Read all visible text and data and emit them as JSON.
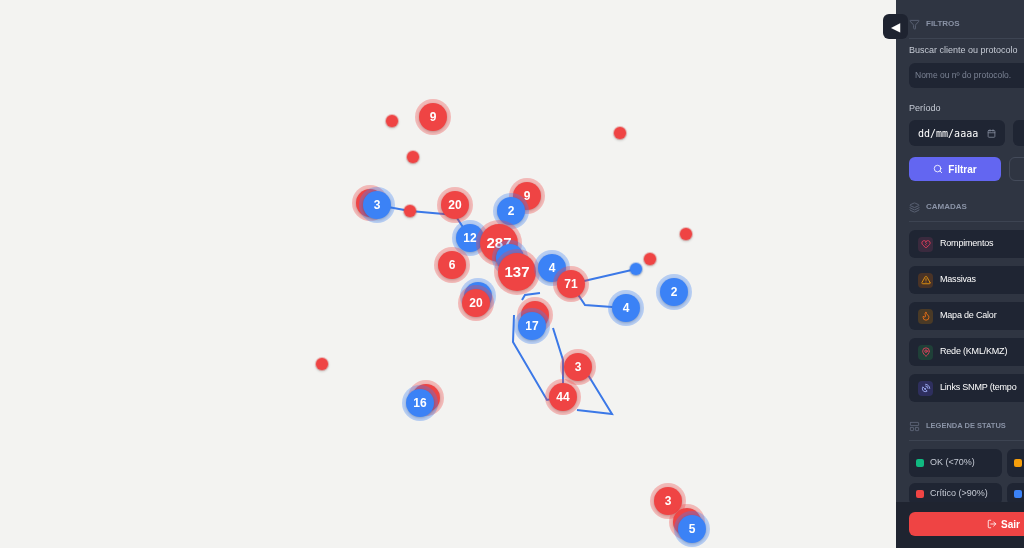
{
  "map": {
    "markers": [
      {
        "kind": "cluster",
        "color": "#ef4444",
        "count": "9"
      },
      {
        "kind": "dot",
        "color": "#ef4444"
      },
      {
        "kind": "dot",
        "color": "#ef4444"
      },
      {
        "kind": "dot",
        "color": "#ef4444"
      },
      {
        "kind": "cluster",
        "color": "#ef4444",
        "count": "9"
      },
      {
        "kind": "cluster",
        "color": "#ef4444"
      },
      {
        "kind": "cluster",
        "color": "#3b82f6",
        "count": "3"
      },
      {
        "kind": "cluster",
        "color": "#ef4444",
        "count": "20"
      },
      {
        "kind": "dot",
        "color": "#ef4444"
      },
      {
        "kind": "cluster",
        "color": "#3b82f6",
        "count": "2"
      },
      {
        "kind": "dot",
        "color": "#ef4444"
      },
      {
        "kind": "cluster",
        "color": "#3b82f6",
        "count": "12"
      },
      {
        "kind": "large",
        "color": "#ef4444",
        "count": "287"
      },
      {
        "kind": "cluster",
        "color": "#3b82f6"
      },
      {
        "kind": "dot",
        "color": "#ef4444"
      },
      {
        "kind": "cluster",
        "color": "#ef4444",
        "count": "6"
      },
      {
        "kind": "large",
        "color": "#ef4444",
        "count": "137"
      },
      {
        "kind": "cluster",
        "color": "#3b82f6",
        "count": "4"
      },
      {
        "kind": "dot",
        "color": "#3b82f6"
      },
      {
        "kind": "cluster",
        "color": "#ef4444",
        "count": "71"
      },
      {
        "kind": "cluster",
        "color": "#3b82f6",
        "count": "2"
      },
      {
        "kind": "cluster",
        "color": "#3b82f6"
      },
      {
        "kind": "cluster",
        "color": "#ef4444",
        "count": "20"
      },
      {
        "kind": "cluster",
        "color": "#3b82f6",
        "count": "4"
      },
      {
        "kind": "cluster",
        "color": "#ef4444"
      },
      {
        "kind": "cluster",
        "color": "#3b82f6",
        "count": "17"
      },
      {
        "kind": "dot",
        "color": "#ef4444"
      },
      {
        "kind": "cluster",
        "color": "#ef4444",
        "count": "3"
      },
      {
        "kind": "cluster",
        "color": "#ef4444"
      },
      {
        "kind": "cluster",
        "color": "#3b82f6",
        "count": "16"
      },
      {
        "kind": "cluster",
        "color": "#ef4444",
        "count": "44"
      },
      {
        "kind": "cluster",
        "color": "#ef4444",
        "count": "3"
      },
      {
        "kind": "cluster",
        "color": "#ef4444"
      },
      {
        "kind": "cluster",
        "color": "#3b82f6",
        "count": "5"
      }
    ]
  },
  "toggle": {
    "icon": "◀"
  },
  "filters": {
    "title": "FILTROS",
    "search_label": "Buscar cliente ou protocolo",
    "search": {
      "placeholder": "Nome ou nº do protocolo."
    },
    "period_label": "Período",
    "date_from": "dd/mm/aaaa",
    "filter_button": "Filtrar"
  },
  "layers": {
    "title": "CAMADAS",
    "items": [
      {
        "kind": "broken-heart",
        "label": "Rompimentos"
      },
      {
        "kind": "warning",
        "label": "Massivas"
      },
      {
        "kind": "flame",
        "label": "Mapa de Calor"
      },
      {
        "kind": "pin",
        "label": "Rede (KML/KMZ)"
      },
      {
        "kind": "dish",
        "label": "Links SNMP (tempo"
      }
    ]
  },
  "legend": {
    "title": "LEGENDA DE STATUS",
    "items": [
      {
        "label": "OK (<70%)",
        "color": "#10b981"
      },
      {
        "color": "#f59e0b"
      },
      {
        "label": "Crítico (>90%)",
        "color": "#ef4444"
      },
      {
        "color": "#3b82f6"
      }
    ]
  },
  "logout_button": "Sair"
}
